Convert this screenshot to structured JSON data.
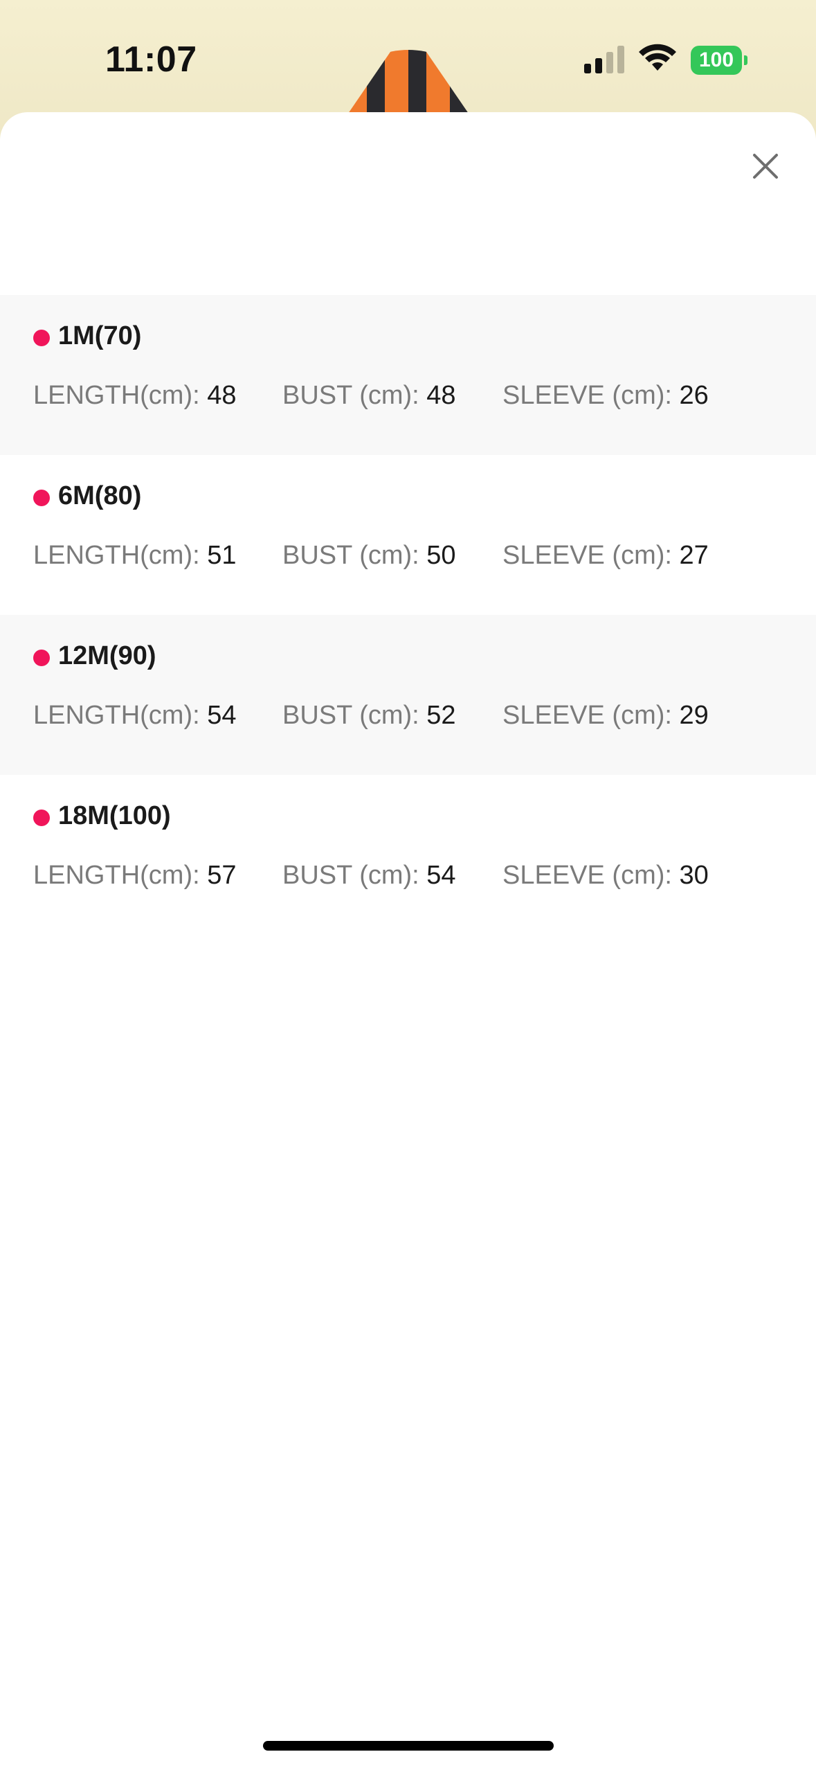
{
  "status_bar": {
    "time": "11:07",
    "battery": "100",
    "icons": [
      "signal-icon",
      "wifi-icon",
      "battery-icon"
    ]
  },
  "sheet": {
    "close_icon": "close-icon",
    "accent_color": "#f0155a"
  },
  "sizes": [
    {
      "name": "1M(70)",
      "length_label": "LENGTH(cm): ",
      "length": "48",
      "bust_label": "BUST (cm): ",
      "bust": "48",
      "sleeve_label": "SLEEVE (cm): ",
      "sleeve": "26"
    },
    {
      "name": "6M(80)",
      "length_label": "LENGTH(cm): ",
      "length": "51",
      "bust_label": "BUST (cm): ",
      "bust": "50",
      "sleeve_label": "SLEEVE (cm): ",
      "sleeve": "27"
    },
    {
      "name": "12M(90)",
      "length_label": "LENGTH(cm): ",
      "length": "54",
      "bust_label": "BUST (cm): ",
      "bust": "52",
      "sleeve_label": "SLEEVE (cm): ",
      "sleeve": "29"
    },
    {
      "name": "18M(100)",
      "length_label": "LENGTH(cm): ",
      "length": "57",
      "bust_label": "BUST (cm): ",
      "bust": "54",
      "sleeve_label": "SLEEVE (cm): ",
      "sleeve": "30"
    }
  ]
}
